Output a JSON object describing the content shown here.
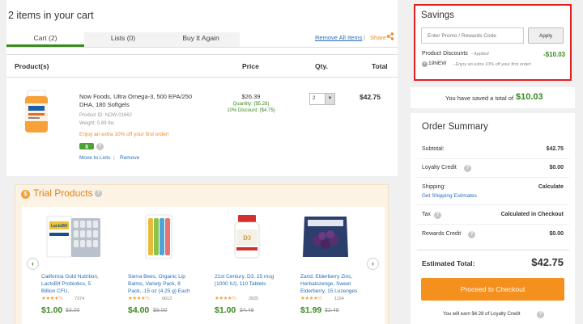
{
  "cart": {
    "title": "2 items in your cart",
    "tabs": [
      "Cart (2)",
      "Lists (0)",
      "Buy It Again"
    ],
    "remove_all": "Remove All Items",
    "separator": "|",
    "share": "Share",
    "columns": [
      "Product(s)",
      "Price",
      "Qty.",
      "Total"
    ],
    "item": {
      "name": "Now Foods, Ultra Omega-3, 500 EPA/250 DHA, 180 Softgels",
      "product_id": "Product ID: NOW-01662",
      "weight": "Weight: 0.89 lbs",
      "extra_offer": "Enjoy an extra 10% off your first order!",
      "loyalty_badge": "$",
      "move_to_lists": "Move to Lists",
      "sep": "|",
      "remove": "Remove",
      "price": "$26.39",
      "quantity_discount": "Quantity: ($5.28)",
      "percent_discount": "10% Discount: ($4.75)",
      "qty": "2",
      "total": "$42.75"
    }
  },
  "trial": {
    "coin": "$",
    "title": "Trial Products",
    "products": [
      {
        "name": "California Gold Nutrition, LactoBif Probiotics, 5 Billion CFU,",
        "stars": "★★★★½",
        "reviews": "7374",
        "price": "$1.00",
        "old_price": "$3.00"
      },
      {
        "name": "Sierra Bees, Organic Lip Balms, Variety Pack, 8 Pack, .15 oz (4.25 g) Each",
        "stars": "★★★★½",
        "reviews": "6613",
        "price": "$4.00",
        "old_price": "$8.00"
      },
      {
        "name": "21st Century, D3, 25 mcg (1000 IU), 110 Tablets",
        "stars": "★★★★½",
        "reviews": "2825",
        "price": "$1.00",
        "old_price": "$4.49"
      },
      {
        "name": "Zand, Elderberry Zinc, Herbalozenge, Sweet Elderberry, 15 Lozenges",
        "stars": "★★★★½",
        "reviews": "1164",
        "price": "$1.99",
        "old_price": "$2.49"
      }
    ]
  },
  "savings": {
    "title": "Savings",
    "promo_placeholder": "Enter Promo / Rewards Code",
    "apply": "Apply",
    "product_discounts": "Product Discounts",
    "applied": "- Applied",
    "discount_amount": "-$10.03",
    "code": "19NEW",
    "code_desc": "- Enjoy an extra 10% off your first order!",
    "saved_prefix": "You have saved a total of",
    "saved_amount": "$10.03"
  },
  "summary": {
    "title": "Order Summary",
    "rows": [
      {
        "label": "Subtotal:",
        "value": "$42.75"
      },
      {
        "label": "Loyalty Credit",
        "value": "$0.00"
      },
      {
        "label": "Shipping:",
        "value": "Calculate",
        "sub": "Get Shipping Estimates"
      },
      {
        "label": "Tax",
        "value": "Calculated in Checkout"
      },
      {
        "label": "Rewards Credit",
        "value": "$0.00"
      }
    ],
    "estimated_label": "Estimated Total:",
    "estimated_value": "$42.75",
    "checkout": "Proceed to Checkout",
    "earn_note": "You will earn $4.28 of Loyalty Credit"
  },
  "colors": {
    "accent_green": "#3a8a1f",
    "orange": "#f4901e",
    "link": "#2a6db8",
    "highlight_red": "#e02020"
  }
}
